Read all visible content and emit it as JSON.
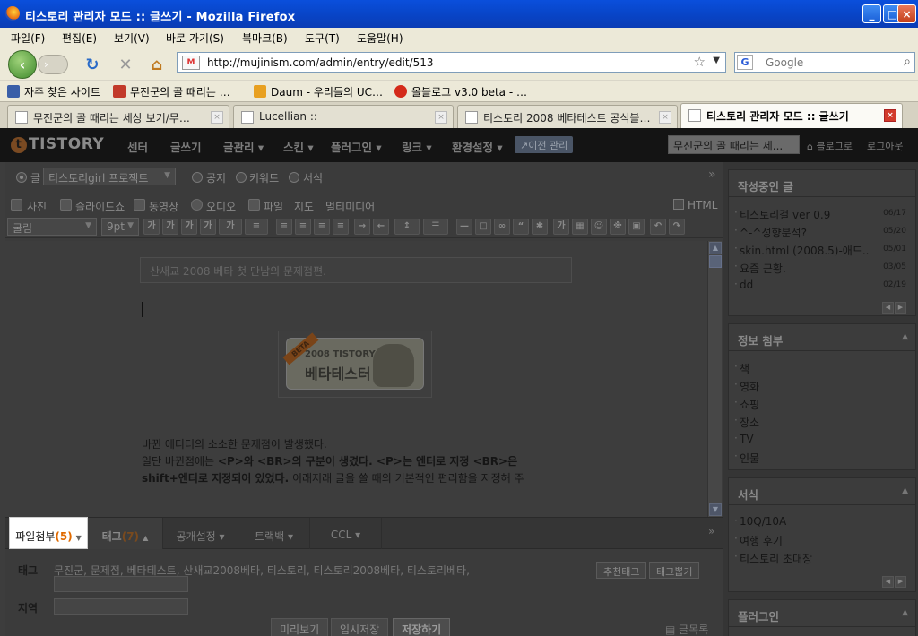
{
  "window": {
    "title": "티스토리 관리자 모드 :: 글쓰기 - Mozilla Firefox"
  },
  "menu": [
    "파일(F)",
    "편집(E)",
    "보기(V)",
    "바로 가기(S)",
    "북마크(B)",
    "도구(T)",
    "도움말(H)"
  ],
  "nav": {
    "url": "http://mujinism.com/admin/entry/edit/513",
    "search_placeholder": "Google",
    "search_engine": "G"
  },
  "bookmarks": [
    {
      "label": "자주 찾은 사이트",
      "color": "#3a5fa8"
    },
    {
      "label": "무진군의 골 때리는 …",
      "color": "#c23a2a"
    },
    {
      "label": "Daum - 우리들의 UC…",
      "color": "#e8a020"
    },
    {
      "label": "올블로그 v3.0 beta - …",
      "color": "#d42a1a"
    }
  ],
  "tabs": [
    {
      "label": "무진군의 골 때리는 세상 보기/무…",
      "active": false
    },
    {
      "label": "Lucellian ::",
      "active": false
    },
    {
      "label": "티스토리 2008 베타테스트 공식블…",
      "active": false
    },
    {
      "label": "티스토리 관리자 모드 :: 글쓰기",
      "active": true
    }
  ],
  "tistory": {
    "logo": "TISTORY",
    "logo_mark": "t",
    "menu": [
      "센터",
      "글쓰기",
      "글관리 ▾",
      "스킨 ▾",
      "플러그인 ▾",
      "링크 ▾",
      "환경설정 ▾"
    ],
    "old_admin": "↗이전 관리",
    "blog_select": "무진군의 골 때리는 세...",
    "to_blog": "블로그로",
    "logout": "로그아웃"
  },
  "editor": {
    "radio": {
      "post": "글",
      "notice": "공지",
      "keyword": "키워드",
      "form": "서식"
    },
    "category": "티스토리girl 프로젝트",
    "media": [
      "사진",
      "슬라이드쇼",
      "동영상",
      "오디오",
      "파일",
      "지도",
      "멀티미디어"
    ],
    "html_label": "HTML",
    "font": "굴림",
    "size": "9pt",
    "title_text": "산새교 2008 베타 첫 만남의 문제점편.",
    "banner_ribbon": "BETA",
    "banner_year": "2008 TISTORY",
    "banner_title": "베타테스터",
    "body_line1": "바뀐 에디터의 소소한 문제점이 발생했다.",
    "body_line2a": "일단 바뀐점에는 ",
    "body_line2b": "<P>와 <BR>의 구분이 생겼다. <P>는 엔터로 지정 <BR>은",
    "body_line3a": "shift+엔터로 지정되어 있었다.",
    "body_line3b": " 이래저래 글을 쓸 때의 기본적인 편리함을 지정해 주"
  },
  "bottom_tabs": {
    "attach": "파일첨부",
    "attach_count": "(5)",
    "tag": "태그",
    "tag_count": "(7)",
    "publish": "공개설정 ▾",
    "trackback": "트랙백 ▾",
    "ccl": "CCL ▾"
  },
  "fields": {
    "tag_label": "태그",
    "tags": "무진군, 문제점, 베타테스트, 산새교2008베타, 티스토리, 티스토리2008베타, 티스토리베타,",
    "recommend_btn": "추천태그",
    "extract_btn": "태그뽑기",
    "region_label": "지역"
  },
  "actions": {
    "preview": "미리보기",
    "temp_save": "임시저장",
    "save": "저장하기",
    "list": "글목록"
  },
  "sidebar": {
    "writing": {
      "title": "작성중인 글",
      "items": [
        {
          "t": "티스토리걸 ver 0.9",
          "d": "06/17"
        },
        {
          "t": "^-^성향분석?",
          "d": "05/20"
        },
        {
          "t": "skin.html (2008.5)-애드..",
          "d": "05/01"
        },
        {
          "t": "요즘 근황.",
          "d": "03/05"
        },
        {
          "t": "dd",
          "d": "02/19"
        }
      ]
    },
    "info": {
      "title": "정보 첨부",
      "items": [
        "책",
        "영화",
        "쇼핑",
        "장소",
        "TV",
        "인물"
      ]
    },
    "format": {
      "title": "서식",
      "items": [
        "10Q/10A",
        "여행 후기",
        "티스토리 초대장"
      ]
    },
    "plugin": {
      "title": "플러그인"
    }
  }
}
